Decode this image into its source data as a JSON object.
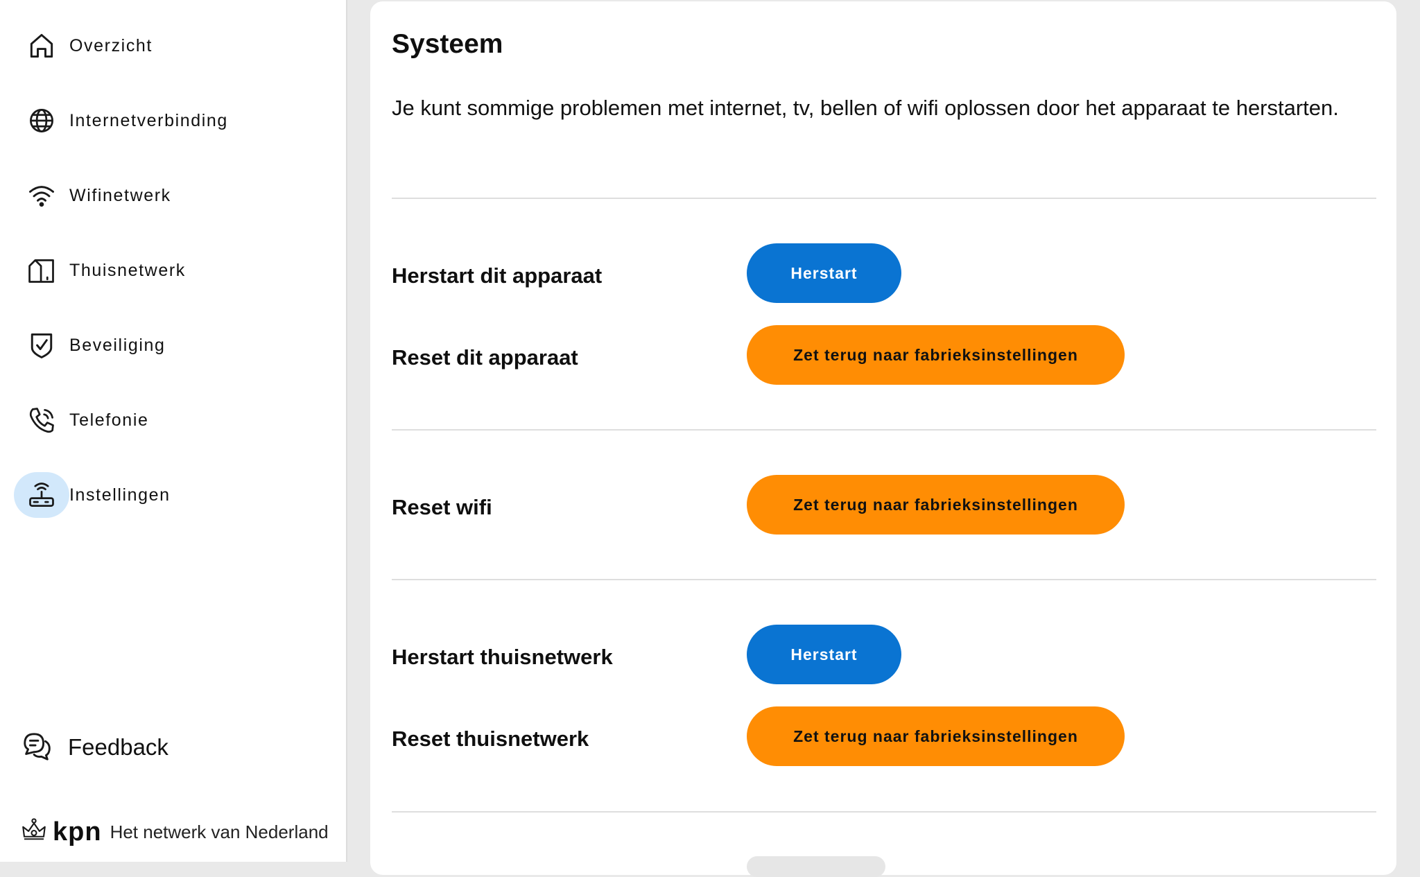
{
  "sidebar": {
    "items": [
      {
        "label": "Overzicht",
        "icon": "home-icon"
      },
      {
        "label": "Internetverbinding",
        "icon": "globe-icon"
      },
      {
        "label": "Wifinetwerk",
        "icon": "wifi-icon"
      },
      {
        "label": "Thuisnetwerk",
        "icon": "home-network-icon"
      },
      {
        "label": "Beveiliging",
        "icon": "shield-check-icon"
      },
      {
        "label": "Telefonie",
        "icon": "phone-icon"
      },
      {
        "label": "Instellingen",
        "icon": "router-icon",
        "active": true
      }
    ],
    "feedback_label": "Feedback",
    "brand": {
      "logo_text": "kpn",
      "tagline": "Het netwerk van Nederland"
    }
  },
  "main": {
    "title": "Systeem",
    "intro": "Je kunt sommige problemen met internet, tv, bellen of wifi oplossen door het apparaat te herstarten.",
    "rows": [
      {
        "label": "Herstart dit apparaat",
        "button": "Herstart"
      },
      {
        "label": "Reset dit apparaat",
        "button": "Zet terug naar fabrieksinstellingen"
      },
      {
        "label": "Reset wifi",
        "button": "Zet terug naar fabrieksinstellingen"
      },
      {
        "label": "Herstart thuisnetwerk",
        "button": "Herstart"
      },
      {
        "label": "Reset thuisnetwerk",
        "button": "Zet terug naar fabrieksinstellingen"
      }
    ]
  },
  "colors": {
    "primary_blue": "#0a74d2",
    "warning_orange": "#ff8d04",
    "active_nav_bg": "#d2e8fb"
  }
}
